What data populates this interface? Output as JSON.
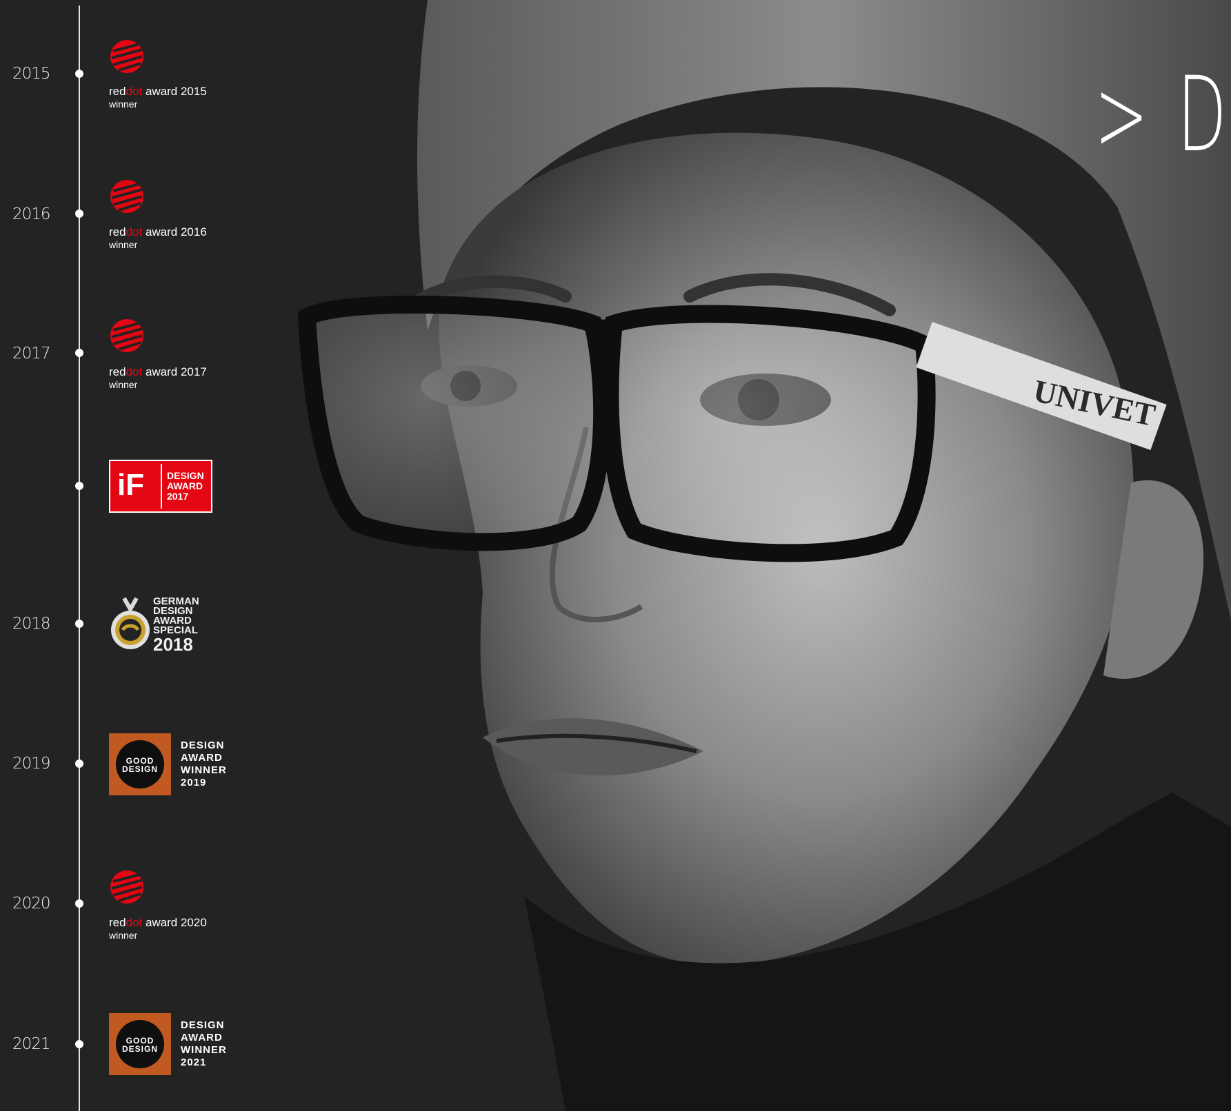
{
  "headline": "> D",
  "photo": {
    "brand_text": "UNIVET"
  },
  "timeline": [
    {
      "year": "2015",
      "kind": "reddot",
      "red": "red",
      "dot": "dot",
      "rest": " award 2015",
      "sub": "winner"
    },
    {
      "year": "2016",
      "kind": "reddot",
      "red": "red",
      "dot": "dot",
      "rest": " award 2016",
      "sub": "winner"
    },
    {
      "year": "2017",
      "kind": "reddot",
      "red": "red",
      "dot": "dot",
      "rest": " award 2017",
      "sub": "winner"
    },
    {
      "year": "",
      "kind": "if",
      "logo_letters": "iF",
      "text_lines": [
        "DESIGN",
        "AWARD",
        "2017"
      ]
    },
    {
      "year": "2018",
      "kind": "german",
      "text_lines": [
        "GERMAN",
        "DESIGN",
        "AWARD",
        "SPECIAL"
      ],
      "big": "2018"
    },
    {
      "year": "2019",
      "kind": "good",
      "circle_lines": [
        "GOOD",
        "DESIGN"
      ],
      "text_lines": [
        "DESIGN",
        "AWARD",
        "WINNER",
        "2019"
      ]
    },
    {
      "year": "2020",
      "kind": "reddot",
      "red": "red",
      "dot": "dot",
      "rest": " award 2020",
      "sub": "winner"
    },
    {
      "year": "2021",
      "kind": "good",
      "circle_lines": [
        "GOOD",
        "DESIGN"
      ],
      "text_lines": [
        "DESIGN",
        "AWARD",
        "WINNER",
        "2021"
      ]
    }
  ],
  "colors": {
    "reddot_red": "#e30613",
    "good_design_orange": "#c05a20",
    "background": "#232323"
  }
}
